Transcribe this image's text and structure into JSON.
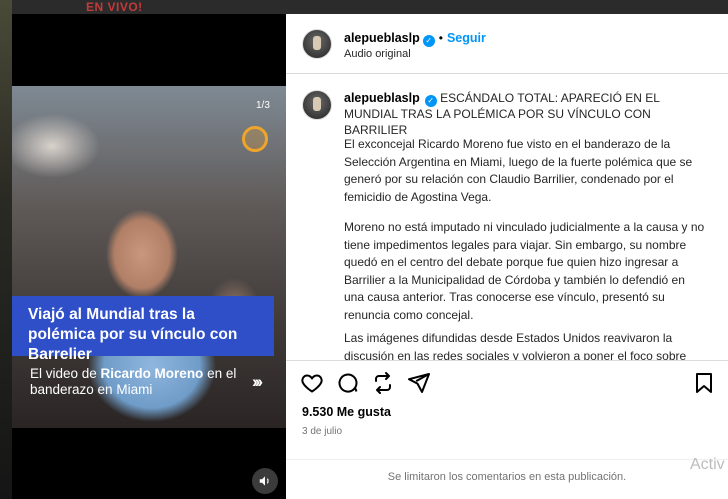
{
  "background": {
    "top_text": "EN VIVO!"
  },
  "media": {
    "counter": "1/3",
    "headline": "Viajó al Mundial tras la polémica por su vínculo con Barrelier",
    "caption_pre": "El video de ",
    "caption_bold": "Ricardo Moreno",
    "caption_post": " en el banderazo en Miami",
    "next_glyph": "›››",
    "icons": [
      "sun-logo-icon",
      "speaker-icon"
    ]
  },
  "post": {
    "username": "alepueblaslp",
    "dot": "•",
    "follow_label": "Seguir",
    "audio_label": "Audio original",
    "caption_title": "ESCÁNDALO TOTAL: APARECIÓ EN EL MUNDIAL TRAS LA POLÉMICA POR SU VÍNCULO CON BARRILIER",
    "paragraphs": [
      "El exconcejal Ricardo Moreno fue visto en el banderazo de la Selección Argentina en Miami, luego de la fuerte polémica que se generó por su relación con Claudio Barrilier, condenado por el femicidio de Agostina Vega.",
      "Moreno no está imputado ni vinculado judicialmente a la causa y no tiene impedimentos legales para viajar. Sin embargo, su nombre quedó en el centro del debate porque fue quien hizo ingresar a Barrilier a la Municipalidad de Córdoba y también lo defendió en una causa anterior. Tras conocerse ese vínculo, presentó su renuncia como concejal.",
      "Las imágenes difundidas desde Estados Unidos reavivaron la discusión en las redes sociales y volvieron a poner el foco sobre"
    ],
    "likes": "9.530 Me gusta",
    "date": "3 de julio",
    "comments_closed": "Se limitaron los comentarios en esta publicación.",
    "action_icons": [
      "heart-icon",
      "comment-icon",
      "repost-icon",
      "share-icon",
      "bookmark-icon"
    ]
  },
  "watermark": "Activ",
  "colors": {
    "accent": "#0095f6",
    "headline_bg": "#2f4fc9",
    "badge": "#f0a52a"
  }
}
